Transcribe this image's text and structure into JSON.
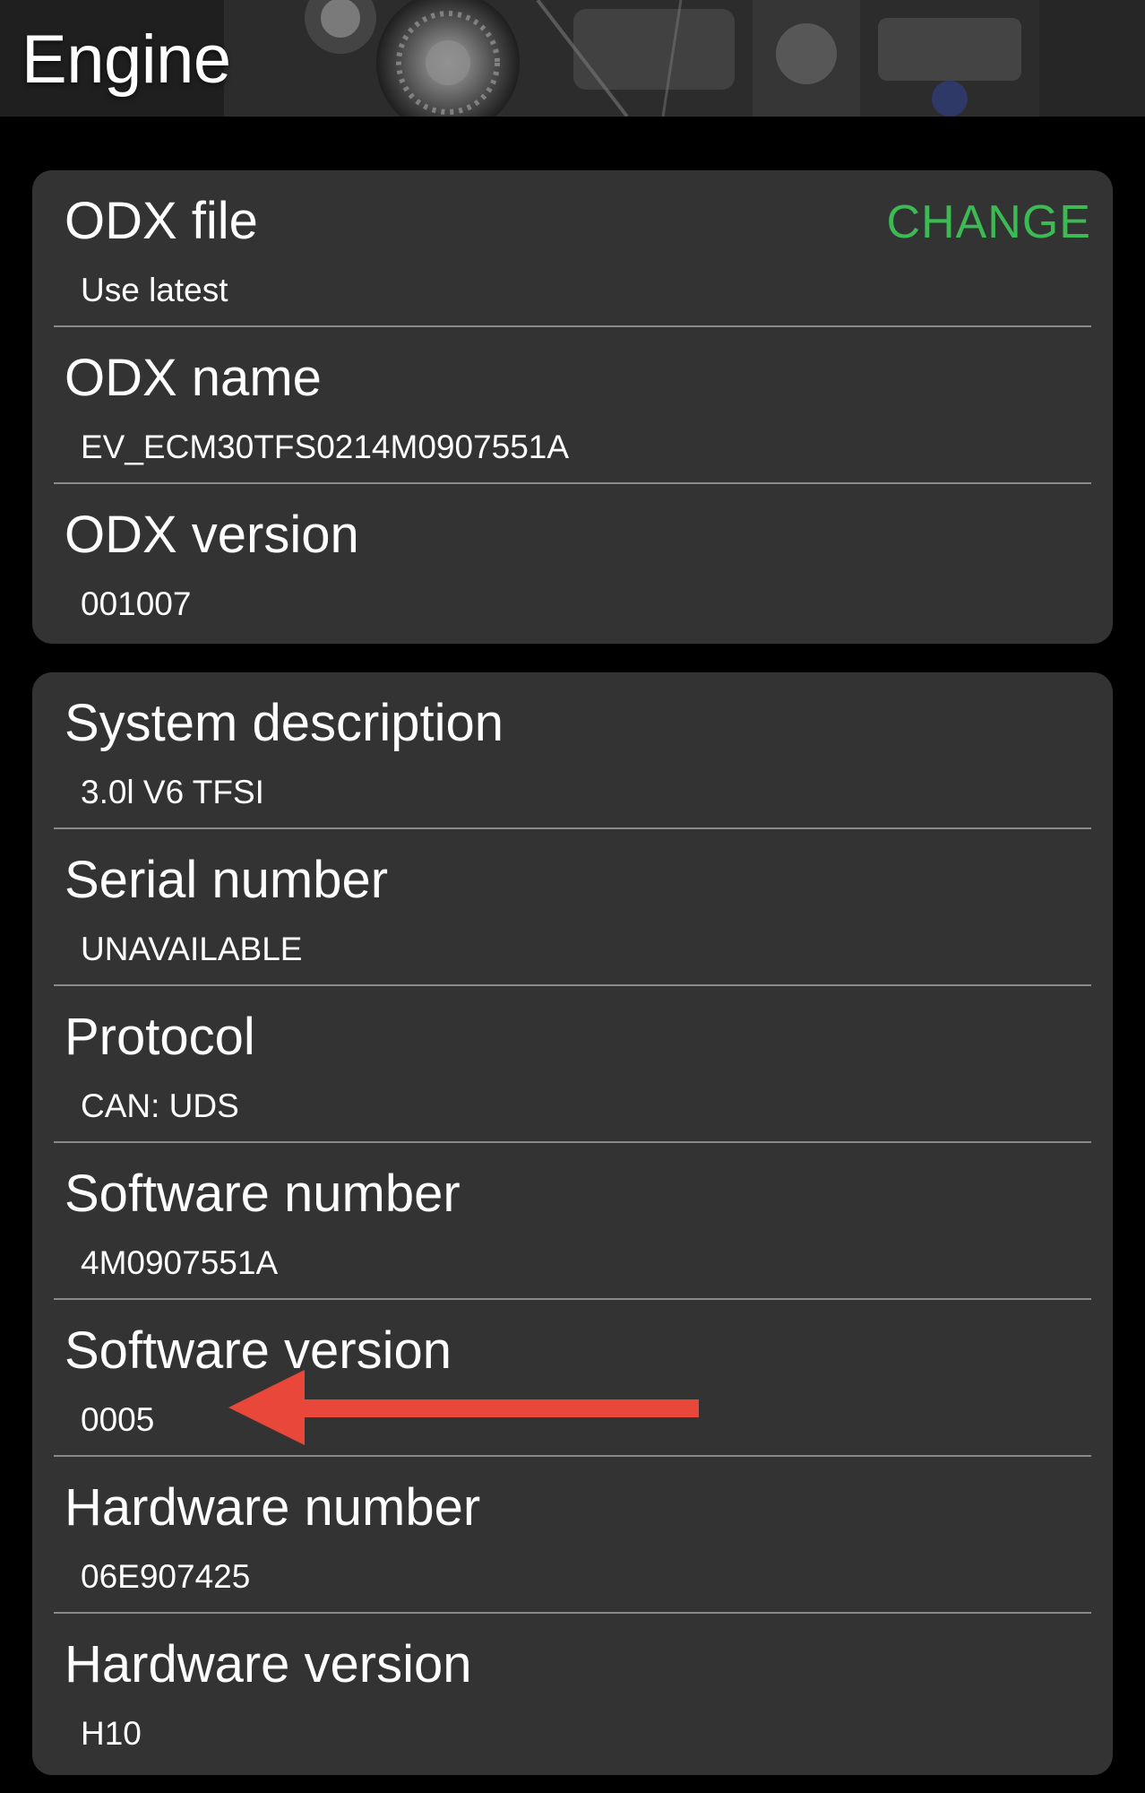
{
  "header": {
    "title": "Engine"
  },
  "odx_card": {
    "rows": [
      {
        "label": "ODX file",
        "value": "Use latest",
        "action": "CHANGE"
      },
      {
        "label": "ODX name",
        "value": "EV_ECM30TFS0214M0907551A"
      },
      {
        "label": "ODX version",
        "value": "001007"
      }
    ]
  },
  "info_card": {
    "rows": [
      {
        "label": "System description",
        "value": "3.0l V6 TFSI"
      },
      {
        "label": "Serial number",
        "value": "UNAVAILABLE"
      },
      {
        "label": "Protocol",
        "value": "CAN: UDS"
      },
      {
        "label": "Software number",
        "value": "4M0907551A"
      },
      {
        "label": "Software version",
        "value": "0005"
      },
      {
        "label": "Hardware number",
        "value": "06E907425"
      },
      {
        "label": "Hardware version",
        "value": "H10"
      }
    ]
  },
  "colors": {
    "accent": "#3cba54",
    "arrow": "#e8473a",
    "card": "#333333",
    "background": "#000000"
  },
  "icons": {
    "annotation": "arrow-left-icon",
    "header_image": "engine-photo"
  }
}
